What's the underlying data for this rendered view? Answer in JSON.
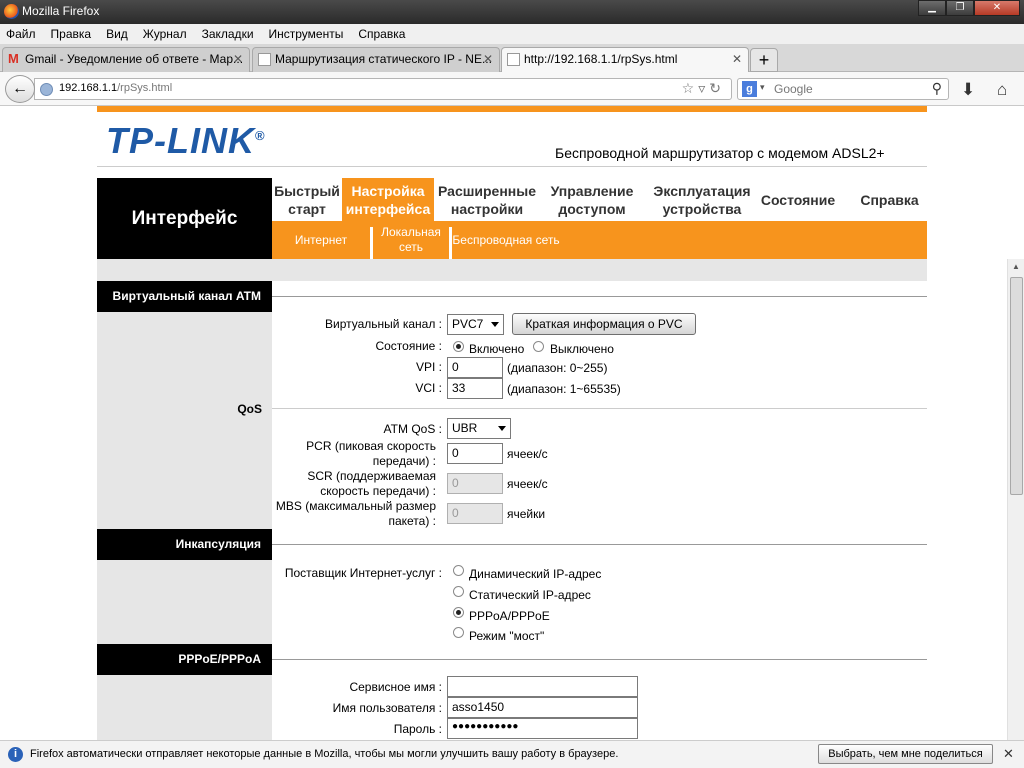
{
  "window": {
    "title": "Mozilla Firefox"
  },
  "menu": [
    "Файл",
    "Правка",
    "Вид",
    "Журнал",
    "Закладки",
    "Инструменты",
    "Справка"
  ],
  "tabs": [
    {
      "label": "Gmail - Уведомление об ответе - Мар...",
      "icon": "gmail-icon",
      "active": false
    },
    {
      "label": "Маршрутизация статического IP - NE...",
      "icon": "page-icon",
      "active": false
    },
    {
      "label": "http://192.168.1.1/rpSys.html",
      "icon": "page-icon",
      "active": true
    }
  ],
  "nav": {
    "url_host": "192.168.1.1",
    "url_path": "/rpSys.html",
    "search_placeholder": "Google"
  },
  "notification": {
    "text": "Firefox автоматически отправляет некоторые данные в Mozilla, чтобы мы могли улучшить вашу работу в браузере.",
    "button": "Выбрать, чем мне поделиться"
  },
  "router": {
    "brand": "TP-LINK",
    "brand_mark": "®",
    "subtitle": "Беспроводной маршрутизатор с модемом ADSL2+",
    "section_title": "Интерфейс",
    "main_nav": [
      {
        "label": "Быстрый старт",
        "active": false
      },
      {
        "label": "Настройка интерфейса",
        "active": true
      },
      {
        "label": "Расширенные настройки",
        "active": false
      },
      {
        "label": "Управление доступом",
        "active": false
      },
      {
        "label": "Эксплуатация устройства",
        "active": false
      },
      {
        "label": "Состояние",
        "active": false
      },
      {
        "label": "Справка",
        "active": false
      }
    ],
    "sub_nav": [
      "Интернет",
      "Локальная сеть",
      "Беспроводная сеть"
    ],
    "atm": {
      "header": "Виртуальный канал ATM",
      "vc_label": "Виртуальный канал :",
      "vc_value": "PVC7",
      "pvc_button": "Краткая информация о PVC",
      "state_label": "Состояние :",
      "state_on": "Включено",
      "state_off": "Выключено",
      "vpi_label": "VPI :",
      "vpi_value": "0",
      "vpi_hint": "(диапазон: 0~255)",
      "vci_label": "VCI :",
      "vci_value": "33",
      "vci_hint": "(диапазон: 1~65535)"
    },
    "qos": {
      "side_label": "QoS",
      "atm_qos_label": "ATM QoS :",
      "atm_qos_value": "UBR",
      "pcr_label": "PCR (пиковая скорость передачи) :",
      "pcr_value": "0",
      "scr_label": "SCR (поддерживаемая скорость передачи) :",
      "scr_value": "0",
      "mbs_label": "MBS (максимальный размер пакета) :",
      "mbs_value": "0",
      "unit_cells": "ячеек/с",
      "unit_cells2": "ячейки"
    },
    "encap": {
      "header": "Инкапсуляция",
      "isp_label": "Поставщик Интернет-услуг :",
      "options": [
        "Динамический IP-адрес",
        "Статический IP-адрес",
        "PPPoA/PPPoE",
        "Режим \"мост\""
      ],
      "selected": 2
    },
    "pppoe": {
      "header": "PPPoE/PPPoA",
      "service_label": "Сервисное имя :",
      "service_value": "",
      "user_label": "Имя пользователя :",
      "user_value": "asso1450",
      "pass_label": "Пароль :",
      "pass_value": "●●●●●●●●●●●"
    }
  }
}
